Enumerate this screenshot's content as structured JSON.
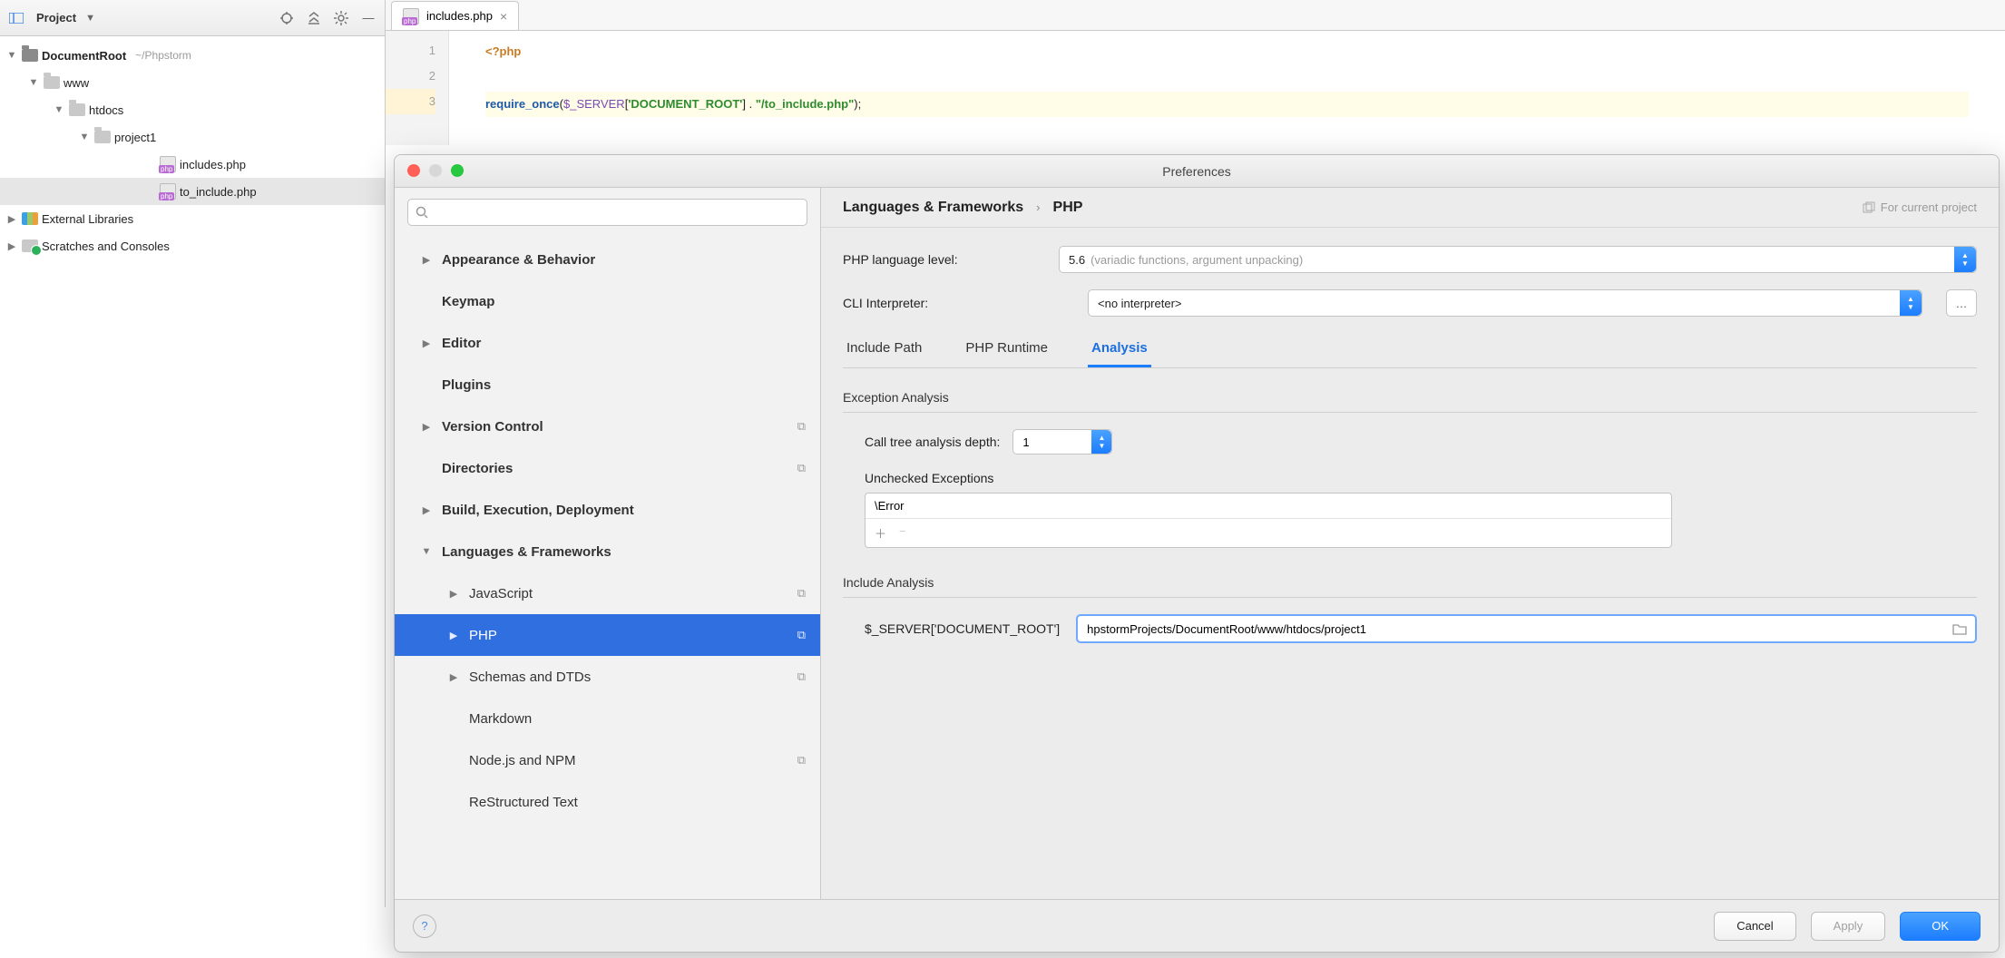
{
  "project_panel": {
    "title": "Project",
    "tree": {
      "root": "DocumentRoot",
      "root_path": "~/Phpstorm",
      "www": "www",
      "htdocs": "htdocs",
      "project1": "project1",
      "file1": "includes.php",
      "file2": "to_include.php",
      "ext_libs": "External Libraries",
      "scratches": "Scratches and Consoles"
    }
  },
  "editor": {
    "tab_name": "includes.php",
    "gutter": [
      "1",
      "2",
      "3"
    ],
    "code": {
      "open_tag": "<?php",
      "fn": "require_once",
      "var": "$_SERVER",
      "idx": "'DOCUMENT_ROOT'",
      "concat": " . ",
      "str": "\"/to_include.php\"",
      "close": ");"
    }
  },
  "prefs": {
    "title": "Preferences",
    "search_placeholder": "",
    "nav": {
      "appearance": "Appearance & Behavior",
      "keymap": "Keymap",
      "editor": "Editor",
      "plugins": "Plugins",
      "vcs": "Version Control",
      "directories": "Directories",
      "build": "Build, Execution, Deployment",
      "lang_fw": "Languages & Frameworks",
      "js": "JavaScript",
      "php": "PHP",
      "schemas": "Schemas and DTDs",
      "markdown": "Markdown",
      "node": "Node.js and NPM",
      "rst": "ReStructured Text"
    },
    "crumb": {
      "a": "Languages & Frameworks",
      "b": "PHP"
    },
    "scope_note": "For current project",
    "php": {
      "lang_level_label": "PHP language level:",
      "lang_level_value": "5.6",
      "lang_level_hint": "(variadic functions, argument unpacking)",
      "cli_label": "CLI Interpreter:",
      "cli_value": "<no interpreter>",
      "tabs": {
        "include_path": "Include Path",
        "runtime": "PHP Runtime",
        "analysis": "Analysis"
      },
      "section_exc": "Exception Analysis",
      "depth_label": "Call tree analysis depth:",
      "depth_value": "1",
      "unchecked_label": "Unchecked Exceptions",
      "unchecked_item": "\\Error",
      "section_inc": "Include Analysis",
      "docroot_var": "$_SERVER['DOCUMENT_ROOT']",
      "docroot_value": "hpstormProjects/DocumentRoot/www/htdocs/project1"
    },
    "footer": {
      "cancel": "Cancel",
      "apply": "Apply",
      "ok": "OK"
    }
  }
}
